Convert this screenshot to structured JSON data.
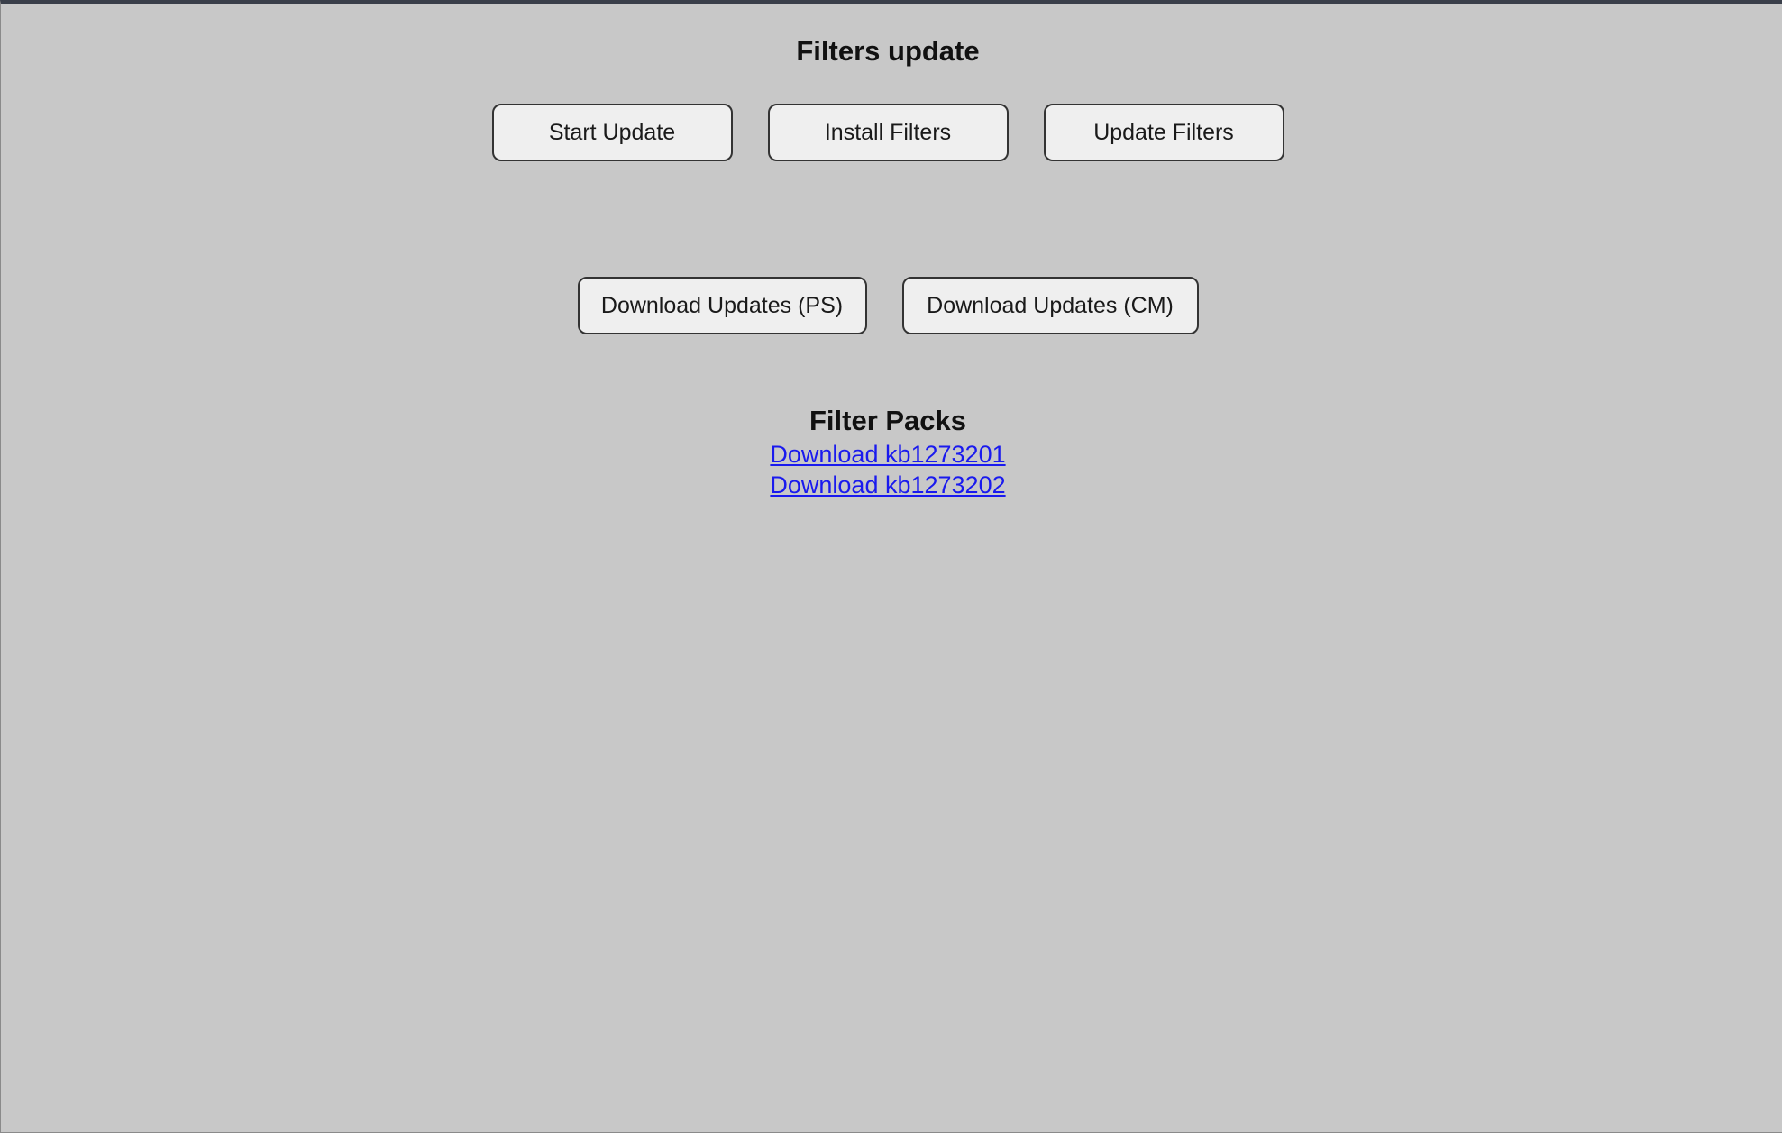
{
  "page": {
    "title": "Filters update"
  },
  "actions": {
    "start_update": "Start Update",
    "install_filters": "Install Filters",
    "update_filters": "Update Filters",
    "download_ps": "Download Updates (PS)",
    "download_cm": "Download Updates (CM)"
  },
  "filter_packs": {
    "heading": "Filter Packs",
    "links": [
      {
        "label": "Download kb1273201"
      },
      {
        "label": "Download kb1273202"
      }
    ]
  },
  "colors": {
    "background": "#c8c8c8",
    "button_bg": "#efefef",
    "button_border": "#333333",
    "link": "#1a1aee",
    "window_frame": "#3a3f4a"
  }
}
